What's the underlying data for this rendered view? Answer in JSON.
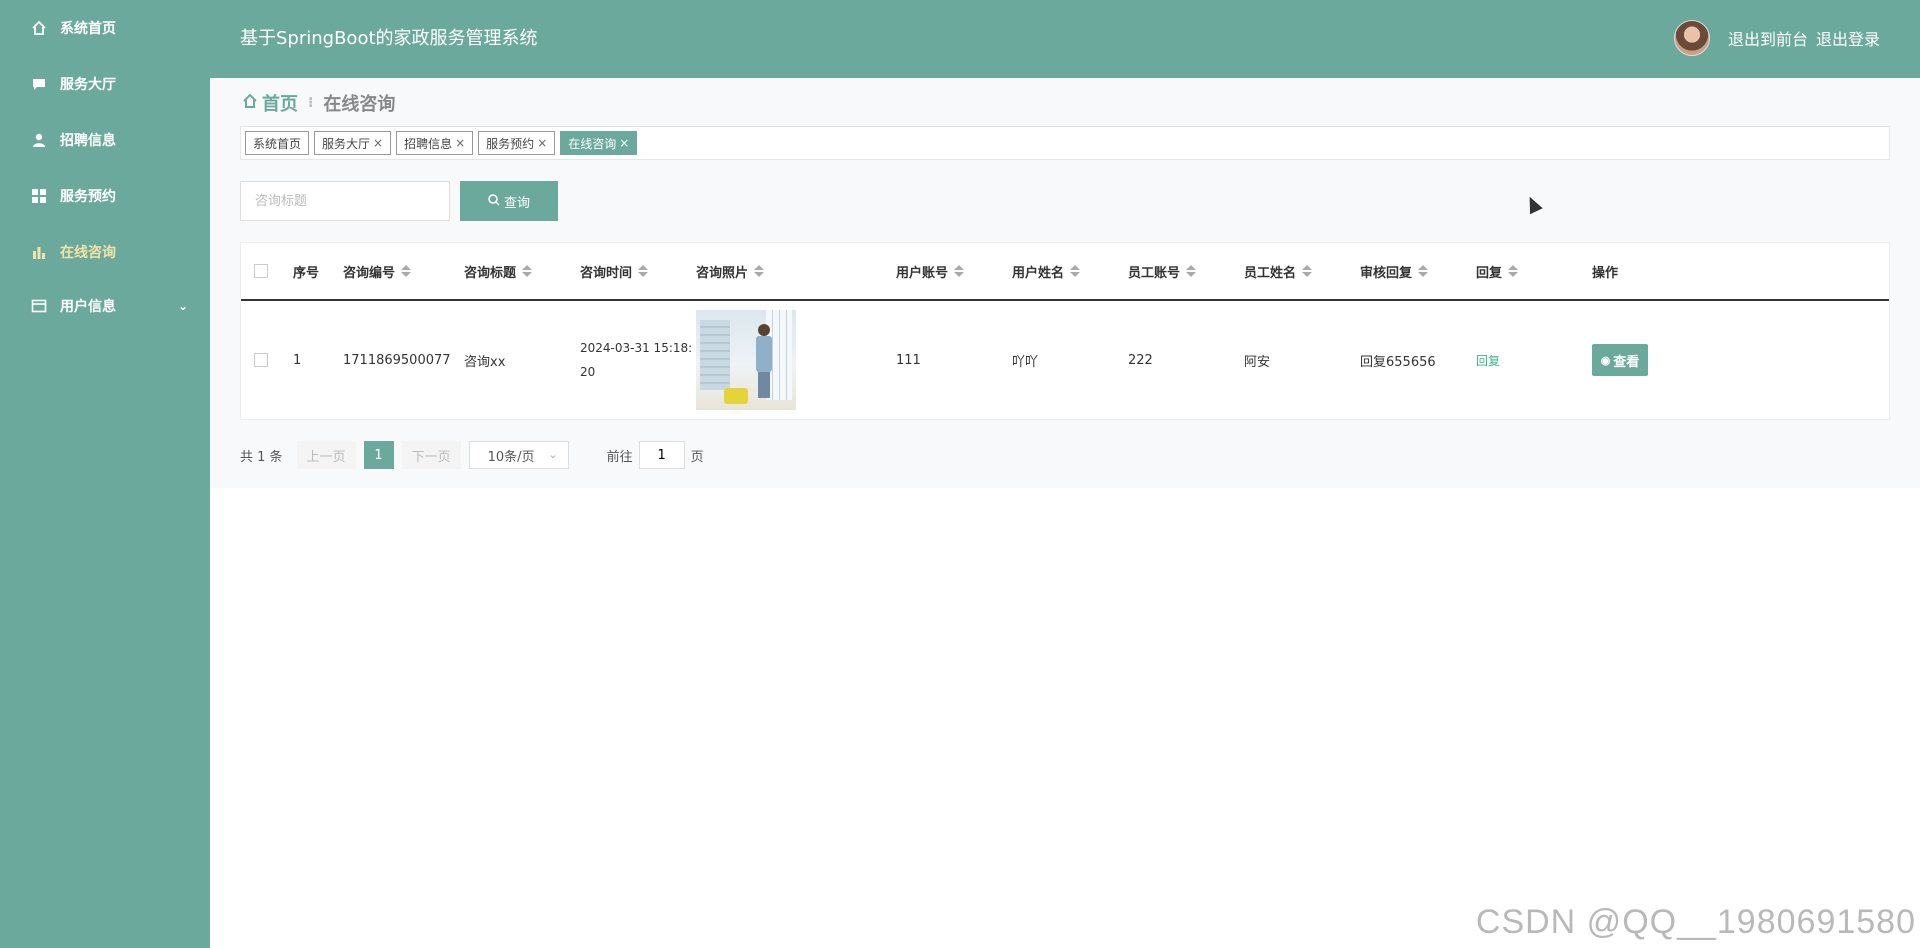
{
  "sidebar": {
    "items": [
      {
        "label": "系统首页",
        "icon": "home-icon"
      },
      {
        "label": "服务大厅",
        "icon": "chat-icon"
      },
      {
        "label": "招聘信息",
        "icon": "user-icon"
      },
      {
        "label": "服务预约",
        "icon": "grid-icon"
      },
      {
        "label": "在线咨询",
        "icon": "bar-chart-icon",
        "active": true
      },
      {
        "label": "用户信息",
        "icon": "card-icon",
        "has_children": true
      }
    ],
    "chevron": "⌄",
    "active_color": "#f3e3a6"
  },
  "header": {
    "title": "基于SpringBoot的家政服务管理系统",
    "front_link": "退出到前台",
    "logout_link": "退出登录"
  },
  "breadcrumb": {
    "home": "首页",
    "separator": "⁝",
    "current": "在线咨询"
  },
  "tabs": [
    {
      "label": "系统首页",
      "closable": false
    },
    {
      "label": "服务大厅",
      "closable": true
    },
    {
      "label": "招聘信息",
      "closable": true
    },
    {
      "label": "服务预约",
      "closable": true
    },
    {
      "label": "在线咨询",
      "closable": true,
      "active": true
    }
  ],
  "tab_close": "×",
  "search": {
    "placeholder": "咨询标题",
    "button_label": "查询"
  },
  "table": {
    "headers": [
      "序号",
      "咨询编号",
      "咨询标题",
      "咨询时间",
      "咨询照片",
      "用户账号",
      "用户姓名",
      "员工账号",
      "员工姓名",
      "审核回复",
      "回复",
      "操作"
    ],
    "rows": [
      {
        "index": "1",
        "consult_no": "1711869500077",
        "title": "咨询xx",
        "time": "2024-03-31 15:18:20",
        "user_account": "111",
        "user_name": "吖吖",
        "staff_account": "222",
        "staff_name": "阿安",
        "review_reply": "回复655656",
        "reply_link": "回复",
        "view_label": "查看"
      }
    ]
  },
  "pagination": {
    "total": "共 1 条",
    "prev": "上一页",
    "page": "1",
    "next": "下一页",
    "page_size": "10条/页",
    "goto_prefix": "前往",
    "goto_value": "1",
    "goto_suffix": "页"
  },
  "watermark": "CSDN @QQ__1980691580",
  "colors": {
    "primary": "#6ba99c",
    "link_green": "#3cb48a"
  }
}
